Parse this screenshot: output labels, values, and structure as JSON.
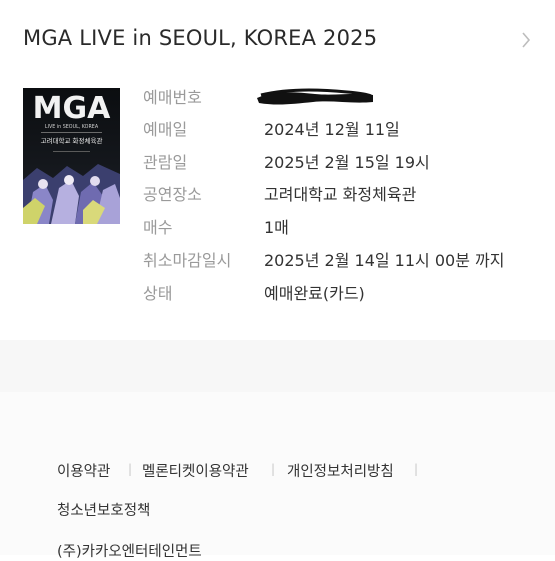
{
  "ticket": {
    "title": "MGA LIVE in SEOUL, KOREA 2025",
    "poster": {
      "logo": "MGA",
      "headline": "LIVE in SEOUL, KOREA",
      "venue_line": "고려대학교 화정체육관"
    },
    "details": [
      {
        "label": "예매번호",
        "value": ""
      },
      {
        "label": "예매일",
        "value": "2024년 12월 11일"
      },
      {
        "label": "관람일",
        "value": "2025년 2월 15일 19시"
      },
      {
        "label": "공연장소",
        "value": "고려대학교 화정체육관"
      },
      {
        "label": "매수",
        "value": "1매"
      },
      {
        "label": "취소마감일시",
        "value": "2025년 2월 14일 11시 00분 까지"
      },
      {
        "label": "상태",
        "value": "예매완료(카드)"
      }
    ]
  },
  "footer": {
    "links": [
      "이용약관",
      "멜론티켓이용약관",
      "개인정보처리방침",
      "청소년보호정책"
    ],
    "company": "(주)카카오엔터테인먼트"
  },
  "colors": {
    "label_gray": "#9a9a9a",
    "footer_bg": "#fbfbfb",
    "redaction": "#111111"
  }
}
